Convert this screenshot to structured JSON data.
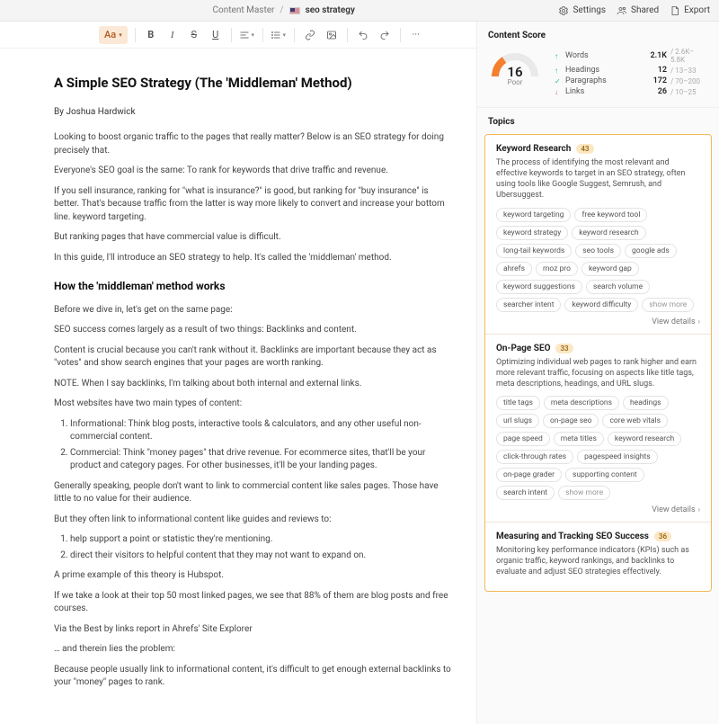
{
  "topbar": {
    "app": "Content Master",
    "doc_title": "seo strategy",
    "settings": "Settings",
    "shared": "Shared",
    "export": "Export"
  },
  "toolbar": {
    "font": "Aa"
  },
  "doc": {
    "title": "A Simple SEO Strategy (The 'Middleman' Method)",
    "byline": "By Joshua Hardwick",
    "p1": "Looking to boost organic traffic to the pages that really matter? Below is an SEO strategy for doing precisely that.",
    "p2": "Everyone's SEO goal is the same: To rank for keywords that drive traffic and revenue.",
    "p3": "If you sell insurance, ranking for \"what is insurance?\" is good, but ranking for \"buy insurance\" is better. That's because traffic from the latter is way more likely to convert and increase your bottom line. keyword targeting.",
    "p4": "But ranking pages that have commercial value is difficult.",
    "p5": "In this guide, I'll introduce an SEO strategy to help. It's called the 'middleman' method.",
    "h2": "How the 'middleman' method works",
    "p6": "Before we dive in, let's get on the same page:",
    "p7": "SEO success comes largely as a result of two things: Backlinks and content.",
    "p8": "Content is crucial because you can't rank without it. Backlinks are important because they act as \"votes\" and show search engines that your pages are worth ranking.",
    "p9": "NOTE. When I say backlinks, I'm talking about both internal and external links.",
    "p10": "Most websites have two main types of content:",
    "li1": "Informational: Think blog posts, interactive tools & calculators, and any other useful non-commercial content.",
    "li2": "Commercial: Think \"money pages\" that drive revenue. For ecommerce sites, that'll be your product and category pages. For other businesses, it'll be your landing pages.",
    "p11": "Generally speaking, people don't want to link to commercial content like sales pages. Those have little to no value for their audience.",
    "p12": "But they often link to informational content like guides and reviews to:",
    "li3": "help support a point or statistic they're mentioning.",
    "li4": "direct their visitors to helpful content that they may not want to expand on.",
    "p13": "A prime example of this theory is Hubspot.",
    "p14": "If we take a look at their top 50 most linked pages, we see that 88% of them are blog posts and free courses.",
    "p15": "Via the Best by links report in Ahrefs' Site Explorer",
    "p16": "… and therein lies the problem:",
    "p17": "Because people usually link to informational content, it's difficult to get enough external backlinks to your \"money\" pages to rank."
  },
  "sidebar": {
    "score_heading": "Content Score",
    "score_value": "16",
    "score_label": "Poor",
    "metrics": [
      {
        "arrow": "↑",
        "cls": "up",
        "label": "Words",
        "value": "2.1K",
        "range": "/ 2.6K–5.8K"
      },
      {
        "arrow": "↑",
        "cls": "up",
        "label": "Headings",
        "value": "12",
        "range": "/ 13–33"
      },
      {
        "arrow": "✓",
        "cls": "ok",
        "label": "Paragraphs",
        "value": "172",
        "range": "/ 70–200"
      },
      {
        "arrow": "↓",
        "cls": "down",
        "label": "Links",
        "value": "26",
        "range": "/ 10–25"
      }
    ],
    "topics_heading": "Topics",
    "view_details": "View details",
    "show_more": "show more",
    "topics": [
      {
        "title": "Keyword Research",
        "count": "43",
        "desc": "The process of identifying the most relevant and effective keywords to target in an SEO strategy, often using tools like Google Suggest, Semrush, and Ubersuggest.",
        "chips": [
          "keyword targeting",
          "free keyword tool",
          "keyword strategy",
          "keyword research",
          "long-tail keywords",
          "seo tools",
          "google ads",
          "ahrefs",
          "moz pro",
          "keyword gap",
          "keyword suggestions",
          "search volume",
          "searcher intent",
          "keyword difficulty"
        ]
      },
      {
        "title": "On-Page SEO",
        "count": "33",
        "desc": "Optimizing individual web pages to rank higher and earn more relevant traffic, focusing on aspects like title tags, meta descriptions, headings, and URL slugs.",
        "chips": [
          "title tags",
          "meta descriptions",
          "headings",
          "url slugs",
          "on-page seo",
          "core web vitals",
          "page speed",
          "meta titles",
          "keyword research",
          "click-through rates",
          "pagespeed insights",
          "on-page grader",
          "supporting content",
          "search intent"
        ]
      },
      {
        "title": "Measuring and Tracking SEO Success",
        "count": "36",
        "desc": "Monitoring key performance indicators (KPIs) such as organic traffic, keyword rankings, and backlinks to evaluate and adjust SEO strategies effectively.",
        "chips": []
      }
    ]
  }
}
